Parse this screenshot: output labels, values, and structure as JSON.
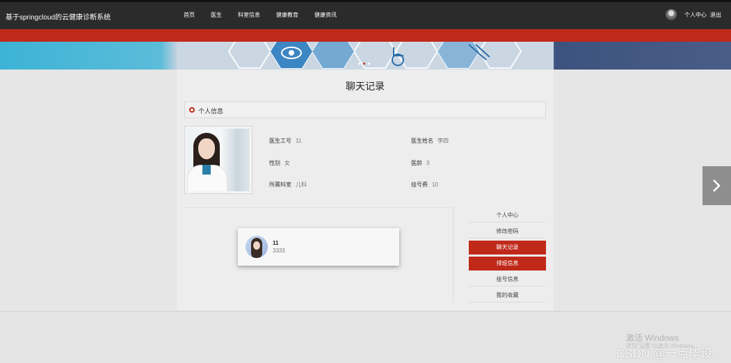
{
  "header": {
    "brand": "基于springcloud的云健康诊断系统",
    "nav": [
      "首页",
      "医生",
      "科室信息",
      "健康教育",
      "健康资讯"
    ],
    "user_center": "个人中心",
    "logout": "退出"
  },
  "page": {
    "title": "聊天记录",
    "section_title": "个人信息"
  },
  "doctor": {
    "id_label": "医生工号",
    "id_value": "11",
    "name_label": "医生姓名",
    "name_value": "李四",
    "gender_label": "性别",
    "gender_value": "女",
    "age_label": "医龄",
    "age_value": "3",
    "dept_label": "所属科室",
    "dept_value": "儿科",
    "fee_label": "挂号费",
    "fee_value": "10"
  },
  "chat": {
    "name": "11",
    "message": "3333"
  },
  "side_menu": {
    "items": [
      {
        "label": "个人中心",
        "active": false
      },
      {
        "label": "修改密码",
        "active": false
      },
      {
        "label": "聊天记录",
        "active": true
      },
      {
        "label": "排班信息",
        "active": true
      },
      {
        "label": "挂号信息",
        "active": false
      },
      {
        "label": "我的收藏",
        "active": false
      }
    ]
  },
  "watermark": {
    "line1": "激活 Windows",
    "line2": "转到\"设置\"以激活 Windows。",
    "csdn": "CSDN @一点毕设"
  },
  "colors": {
    "accent": "#c0291a",
    "topbar": "#2b2b2b"
  }
}
